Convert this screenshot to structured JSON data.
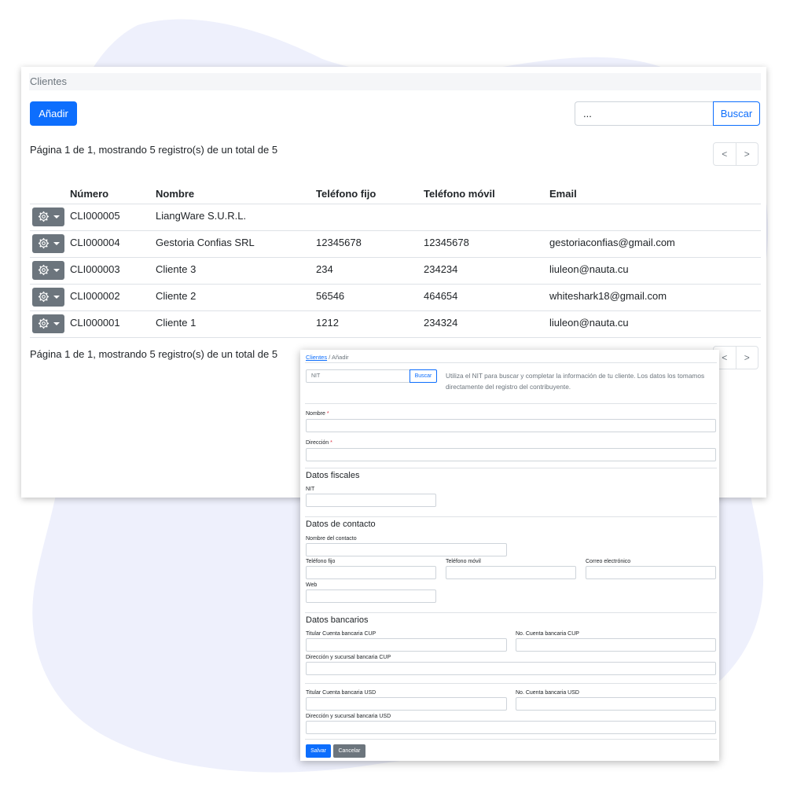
{
  "list": {
    "breadcrumb": "Clientes",
    "add_label": "Añadir",
    "search_value": "...",
    "search_label": "Buscar",
    "page_info": "Página 1 de 1, mostrando 5 registro(s) de un total de 5",
    "pager_prev": "<",
    "pager_next": ">",
    "columns": [
      "Número",
      "Nombre",
      "Teléfono fijo",
      "Teléfono móvil",
      "Email"
    ],
    "rows": [
      {
        "numero": "CLI000005",
        "nombre": "LiangWare S.U.R.L.",
        "fijo": "",
        "movil": "",
        "email": ""
      },
      {
        "numero": "CLI000004",
        "nombre": "Gestoria Confias SRL",
        "fijo": "12345678",
        "movil": "12345678",
        "email": "gestoriaconfias@gmail.com"
      },
      {
        "numero": "CLI000003",
        "nombre": "Cliente 3",
        "fijo": "234",
        "movil": "234234",
        "email": "liuleon@nauta.cu"
      },
      {
        "numero": "CLI000002",
        "nombre": "Cliente 2",
        "fijo": "56546",
        "movil": "464654",
        "email": "whiteshark18@gmail.com"
      },
      {
        "numero": "CLI000001",
        "nombre": "Cliente 1",
        "fijo": "1212",
        "movil": "234324",
        "email": "liuleon@nauta.cu"
      }
    ]
  },
  "form": {
    "breadcrumb_link": "Clientes",
    "breadcrumb_sep": "/",
    "breadcrumb_current": "Añadir",
    "nit_placeholder": "NIT",
    "nit_search_label": "Buscar",
    "help_text": "Utiliza el NIT para buscar y completar la información de tu cliente. Los datos los tomamos directamente del registro del contribuyente.",
    "required_mark": "*",
    "labels": {
      "nombre": "Nombre",
      "direccion": "Dirección",
      "nit": "NIT",
      "nombre_contacto": "Nombre del contacto",
      "telefono_fijo": "Teléfono fijo",
      "telefono_movil": "Teléfono móvil",
      "correo": "Correo electrónico",
      "web": "Web",
      "titular_cup": "Titular Cuenta bancaria CUP",
      "no_cup": "No. Cuenta bancaria CUP",
      "dir_cup": "Dirección y sucursal bancaria CUP",
      "titular_usd": "Titular Cuenta bancaria USD",
      "no_usd": "No. Cuenta bancaria USD",
      "dir_usd": "Dirección y sucursal bancaria USD"
    },
    "sections": {
      "fiscales": "Datos fiscales",
      "contacto": "Datos de contacto",
      "bancarios": "Datos bancarios"
    },
    "save_label": "Salvar",
    "cancel_label": "Cancelar"
  },
  "colors": {
    "primary": "#0d6efd",
    "secondary": "#6c757d",
    "blob": "#eef0fc",
    "required": "#dc3545"
  },
  "icons": {
    "row_action": "gear-icon",
    "dropdown": "caret-down-icon"
  }
}
